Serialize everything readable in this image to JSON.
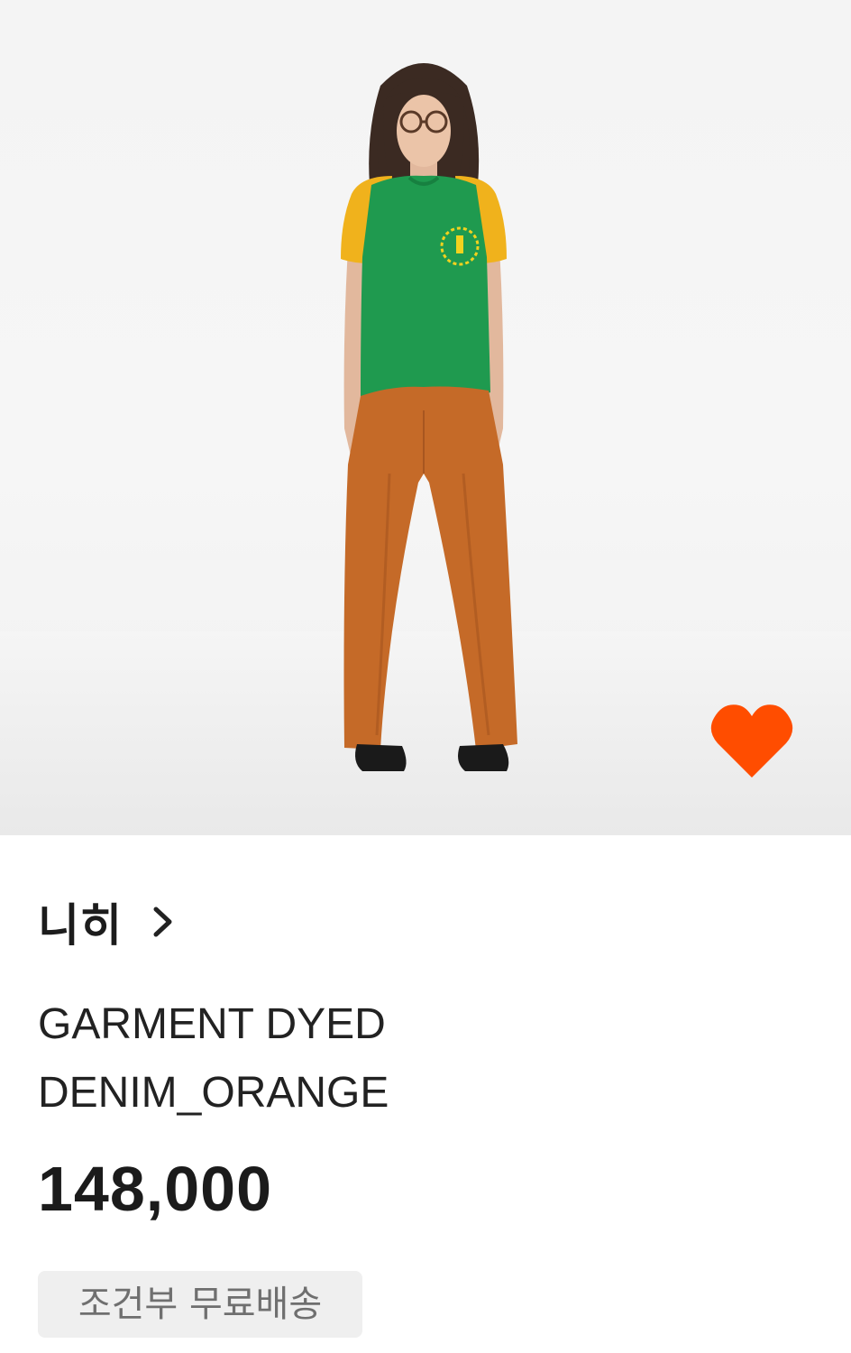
{
  "product": {
    "image_alt": "Model wearing green and yellow t-shirt with orange wide-leg pants",
    "liked": true,
    "brand": "니히",
    "name_line1": "GARMENT DYED",
    "name_line2": "DENIM_ORANGE",
    "price": "148,000",
    "shipping_badge": "조건부 무료배송"
  },
  "colors": {
    "like_heart": "#ff4d00",
    "badge_bg": "#efefef",
    "badge_text": "#6f6f6f",
    "shirt_green": "#1f9a4f",
    "shirt_yellow": "#f0b21c",
    "pants_orange": "#c56a28"
  },
  "icons": {
    "like": "heart-icon",
    "brand_link": "chevron-right-icon"
  }
}
